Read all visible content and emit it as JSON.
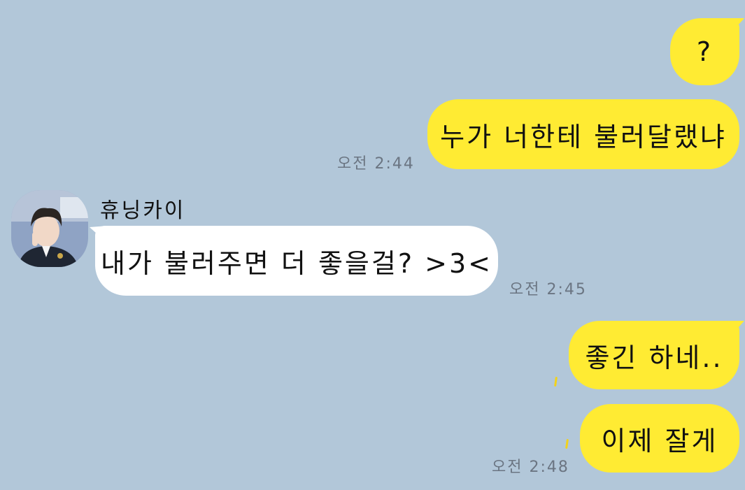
{
  "chat": {
    "accent_me": "#ffeb33",
    "accent_other": "#ffffff",
    "background": "#b2c7d9",
    "messages": [
      {
        "sender": "me",
        "text": "?"
      },
      {
        "sender": "me",
        "text": "누가 너한테 불러달랬냐",
        "time": "오전 2:44"
      },
      {
        "sender": "other",
        "name": "휴닝카이",
        "text": "내가 불러주면 더 좋을걸? >3<",
        "time": "오전 2:45"
      },
      {
        "sender": "me",
        "text": "좋긴 하네.."
      },
      {
        "sender": "me",
        "text": "이제 잘게",
        "time": "오전 2:48"
      }
    ]
  }
}
